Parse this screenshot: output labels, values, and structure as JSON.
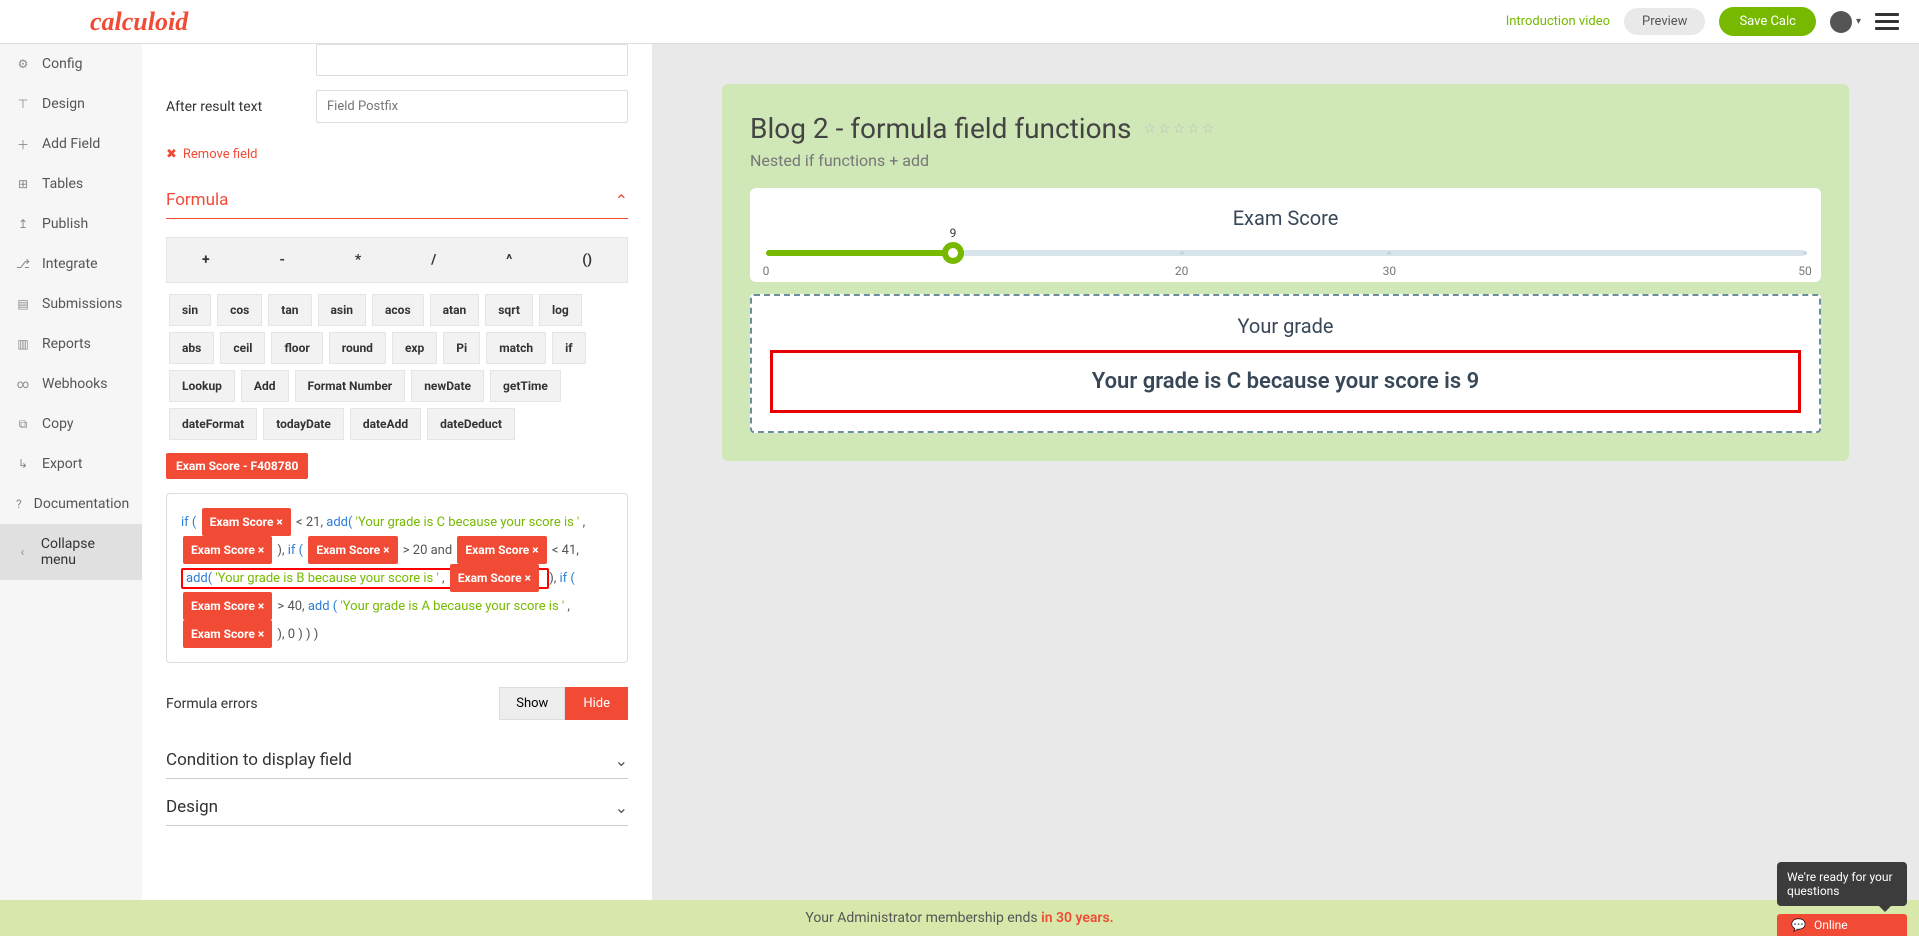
{
  "brand": "calculoid",
  "topbar": {
    "intro": "Introduction video",
    "preview": "Preview",
    "save": "Save Calc"
  },
  "sidebar": {
    "items": [
      {
        "key": "config",
        "label": "Config",
        "icon": "⚙"
      },
      {
        "key": "design",
        "label": "Design",
        "icon": "⊤"
      },
      {
        "key": "addfield",
        "label": "Add Field",
        "icon": "＋"
      },
      {
        "key": "tables",
        "label": "Tables",
        "icon": "⊞"
      },
      {
        "key": "publish",
        "label": "Publish",
        "icon": "↥"
      },
      {
        "key": "integrate",
        "label": "Integrate",
        "icon": "⎇"
      },
      {
        "key": "submissions",
        "label": "Submissions",
        "icon": "▤"
      },
      {
        "key": "reports",
        "label": "Reports",
        "icon": "▥"
      },
      {
        "key": "webhooks",
        "label": "Webhooks",
        "icon": "∞"
      },
      {
        "key": "copy",
        "label": "Copy",
        "icon": "⧉"
      },
      {
        "key": "export",
        "label": "Export",
        "icon": "↳"
      },
      {
        "key": "documentation",
        "label": "Documentation",
        "icon": "?"
      },
      {
        "key": "collapse",
        "label": "Collapse menu",
        "icon": "‹"
      }
    ]
  },
  "editor": {
    "afterResultLabel": "After result text",
    "afterResultPlaceholder": "Field Postfix",
    "removeField": "Remove field",
    "formulaLabel": "Formula",
    "operators": [
      "+",
      "-",
      "*",
      "/",
      "^",
      "()"
    ],
    "funcs": [
      "sin",
      "cos",
      "tan",
      "asin",
      "acos",
      "atan",
      "sqrt",
      "log",
      "abs",
      "ceil",
      "floor",
      "round",
      "exp",
      "Pi",
      "match",
      "if",
      "Lookup",
      "Add",
      "Format Number",
      "newDate",
      "getTime",
      "dateFormat",
      "todayDate",
      "dateAdd",
      "dateDeduct"
    ],
    "fieldTag": "Exam Score - F408780",
    "formula": {
      "tag": "Exam Score ×",
      "if": "if (",
      "add": "add(",
      "addsp": "add (",
      "lt21": " < 21, ",
      "strC": "'Your grade is C because your score is '",
      "comma": ", ",
      "closeIf": "), ",
      "gt20and": " > 20 and ",
      "lt41": " < 41, ",
      "strB": "'Your grade is B because your score is '",
      "gt40": " > 40, ",
      "strA": "'Your grade is A because your score is '",
      "close0": "), 0 ) ) )"
    },
    "errorsLabel": "Formula errors",
    "show": "Show",
    "hide": "Hide",
    "condLabel": "Condition to display field",
    "designLabel": "Design"
  },
  "preview": {
    "title": "Blog 2 - formula field functions",
    "stars": "☆☆☆☆☆",
    "subtitle": "Nested if functions + add",
    "sliderTitle": "Exam Score",
    "sliderValue": "9",
    "ticks": {
      "t0": "0",
      "t20": "20",
      "t30": "30",
      "t50": "50"
    },
    "gradeTitle": "Your grade",
    "gradeResult": "Your grade is C because your score is 9"
  },
  "footer": {
    "pre": "Your Administrator membership ends ",
    "bold": "in 30 years."
  },
  "chat": {
    "bubble": "We're ready for your questions",
    "status": "Online"
  },
  "chart_data": {
    "type": "bar",
    "title": "Exam Score",
    "xlabel": "",
    "ylabel": "",
    "categories": [
      "Exam Score"
    ],
    "values": [
      9
    ],
    "xlim": [
      0,
      50
    ],
    "ticks": [
      0,
      20,
      30,
      50
    ]
  }
}
